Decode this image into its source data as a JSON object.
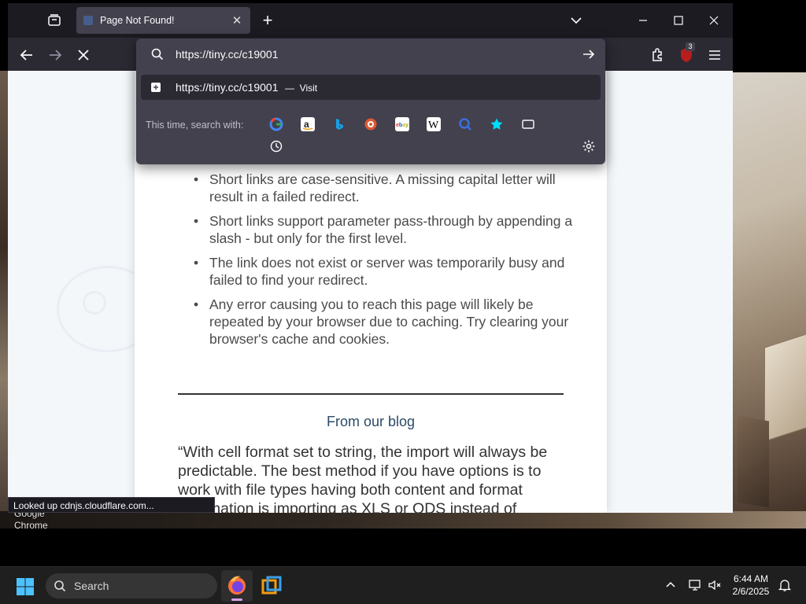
{
  "browser": {
    "tab": {
      "title": "Page Not Found!"
    },
    "urlbar": {
      "value": "https://tiny.cc/c19001",
      "suggestion_url": "https://tiny.cc/c19001",
      "suggestion_separator": "—",
      "suggestion_action": "Visit",
      "search_with_label": "This time, search with:",
      "engines": [
        "google-icon",
        "amazon-icon",
        "bing-icon",
        "duckduckgo-icon",
        "ebay-icon",
        "wikipedia-icon",
        "search-engine-icon",
        "bookmarks-icon",
        "tabs-icon",
        "history-icon"
      ]
    },
    "extension_badge": "3",
    "status_text": "Looked up cdnjs.cloudflare.com..."
  },
  "page": {
    "bullets": [
      "Short links are case-sensitive. A missing capital letter will result in a failed redirect.",
      "Short links support parameter pass-through by appending a slash - but only for the first level.",
      "The link does not exist or server was temporarily busy and failed to find your redirect.",
      "Any error causing you to reach this page will likely be repeated by your browser due to caching. Try clearing your browser's cache and cookies."
    ],
    "blog_heading": "From our blog",
    "blog_quote": "“With cell format set to string, the import will always be predictable. The best method if you have options is to work with file types having both content and format information is importing as XLS or ODS instead of"
  },
  "desktop": {
    "icon_label": "Google Chrome"
  },
  "taskbar": {
    "search_placeholder": "Search",
    "time": "6:44 AM",
    "date": "2/6/2025"
  },
  "colors": {
    "accent_purple": "#d8a0e8",
    "browser_dark": "#1c1b22",
    "url_panel": "#42414d"
  }
}
